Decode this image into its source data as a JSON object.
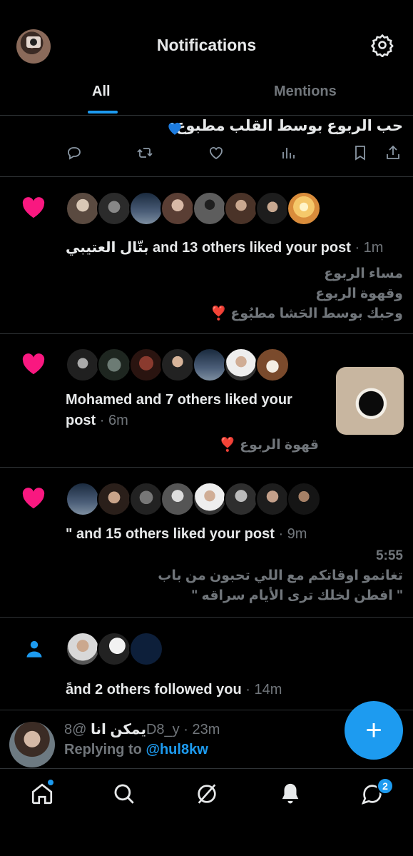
{
  "header": {
    "title": "Notifications"
  },
  "tabs": [
    {
      "label": "All"
    },
    {
      "label": "Mentions"
    }
  ],
  "top_post": {
    "text": "حب الربوع بوسط القلب مطبوع"
  },
  "notifications": [
    {
      "text": "بتّال العتيبي and 13 others liked your post",
      "time": "· 1m",
      "quote": [
        "مساء الربوع",
        "وقهوة الربوع",
        "وحبك بوسط الحَشا مطبُوع ❣️"
      ]
    },
    {
      "text_line1": "Mohamed and 7 others liked your",
      "text_line2": "post",
      "time": "· 6m",
      "quote": "قهوة الربوع ❣️"
    },
    {
      "text": "\" and 15 others liked your post",
      "time": "· 9m",
      "quote_time": "5:55",
      "quote": [
        "تغانمو اوقاتكم مع اللي تحبون من باب",
        "\" افطن لخلك ترى الأيام سراقه \""
      ]
    },
    {
      "text": "ًand 2 others followed you",
      "time": "· 14m"
    }
  ],
  "reply": {
    "name": "يمكن انا",
    "handle": "@8D8_y",
    "time": "· 23m",
    "replying_prefix": "Replying to",
    "replying_handle": "@hul8kw"
  },
  "fab": {
    "label": "+"
  },
  "nav": {
    "messages_badge": "2"
  },
  "colors": {
    "accent": "#1d9bf0",
    "like": "#f91880",
    "background": "#000000"
  }
}
